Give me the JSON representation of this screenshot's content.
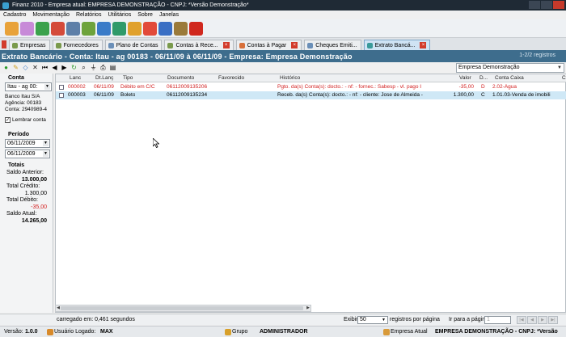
{
  "window": {
    "title": "Finanz 2010 - Empresa atual: EMPRESA DEMONSTRAÇÃO - CNPJ:  *Versão Demonstração*"
  },
  "menu": [
    "Cadastro",
    "Movimentação",
    "Relatórios",
    "Utilitários",
    "Sobre",
    "Janelas"
  ],
  "toolbar_icons": [
    {
      "name": "people-icon",
      "color": "#e8a23a"
    },
    {
      "name": "users-icon",
      "color": "#c78ad8"
    },
    {
      "name": "money-in-icon",
      "color": "#3aa24d"
    },
    {
      "name": "money-out-icon",
      "color": "#d44a3a"
    },
    {
      "name": "pencil-icon",
      "color": "#5d7fa8"
    },
    {
      "name": "cash-icon",
      "color": "#6da33c"
    },
    {
      "name": "card-icon",
      "color": "#3a7bc8"
    },
    {
      "name": "bank-icon",
      "color": "#2f9a6a"
    },
    {
      "name": "report-icon",
      "color": "#e0a12d"
    },
    {
      "name": "calendar-icon",
      "color": "#e24a3a"
    },
    {
      "name": "save-icon",
      "color": "#3a6fc4"
    },
    {
      "name": "tools-icon",
      "color": "#9a7a3a"
    },
    {
      "name": "power-icon",
      "color": "#d0281e"
    }
  ],
  "tabs": [
    {
      "label": "Empresas",
      "active": false,
      "close": false
    },
    {
      "label": "Fornecedores",
      "active": false,
      "close": false
    },
    {
      "label": "Plano de Contas",
      "active": false,
      "close": false
    },
    {
      "label": "Contas à Rece...",
      "active": false,
      "close": true
    },
    {
      "label": "Contas à Pagar",
      "active": false,
      "close": true
    },
    {
      "label": "Cheques Emiti...",
      "active": false,
      "close": false
    },
    {
      "label": "Extrato Bancá...",
      "active": true,
      "close": true
    }
  ],
  "header": {
    "title": "Extrato Bancário - Conta: Itau - ag 00183 - 06/11/09 à 06/11/09   -   Empresa: Empresa Demonstração",
    "count": "1-2/2 registros"
  },
  "company_select": "Empresa Demonstração",
  "left": {
    "conta_label": "Conta",
    "conta_value": "Itau - ag 00:",
    "bank_name": "Banco Itau S/A",
    "agencia": "Agência: 00183",
    "conta": "Conta:     2940989-4",
    "lembrar": "Lembrar conta",
    "periodo_label": "Período",
    "date_from": "06/11/2009",
    "date_to": "06/11/2009",
    "totais_label": "Totais",
    "saldo_anterior_label": "Saldo Anterior:",
    "saldo_anterior": "13.000,00",
    "total_credito_label": "Total Crédito:",
    "total_credito": "1.300,00",
    "total_debito_label": "Total Débito:",
    "total_debito": "-35,00",
    "saldo_atual_label": "Saldo Atual:",
    "saldo_atual": "14.265,00"
  },
  "grid": {
    "columns": [
      "Lanc",
      "Dt.Lanç",
      "Tipo",
      "Documento",
      "Favorecido",
      "Histórico",
      "Valor",
      "D...",
      "Conta Caixa",
      "C"
    ],
    "rows": [
      {
        "lanc": "000002",
        "dt": "06/11/09",
        "tipo": "Débito em C/C",
        "doc": "06112009135206",
        "fav": "",
        "hist": "Pgto. da(s) Conta(s): docto.:  - nf:  - fornec.: Sabesp - vl. pago I",
        "valor": "-35,00",
        "d": "D",
        "conta": "2.02-Água",
        "red": true,
        "selected": false
      },
      {
        "lanc": "000003",
        "dt": "06/11/09",
        "tipo": "Boleto",
        "doc": "06112009135234",
        "fav": "",
        "hist": "Receb. da(s) Conta(s): docto.:  - nf:  - cliente: Jose de Almeida -",
        "valor": "1.300,00",
        "d": "C",
        "conta": "1.01.03-Venda de imobili",
        "red": false,
        "selected": true
      }
    ]
  },
  "footer": {
    "loaded": "carregado em: 0,461 segundos",
    "exibir_label": "Exibir",
    "exibir_value": "50",
    "per_page": "registros por página",
    "ir_label": "Ir para a página",
    "ir_value": "1"
  },
  "status": {
    "versao_label": "Versão:",
    "versao": "1.0.0",
    "usuario_label": "Usuário Logado:",
    "usuario": "MAX",
    "grupo_label": "Grupo",
    "grupo": "ADMINISTRADOR",
    "empresa_label": "Empresa Atual",
    "empresa": "EMPRESA DEMONSTRAÇÃO - CNPJ:  *Versão"
  }
}
